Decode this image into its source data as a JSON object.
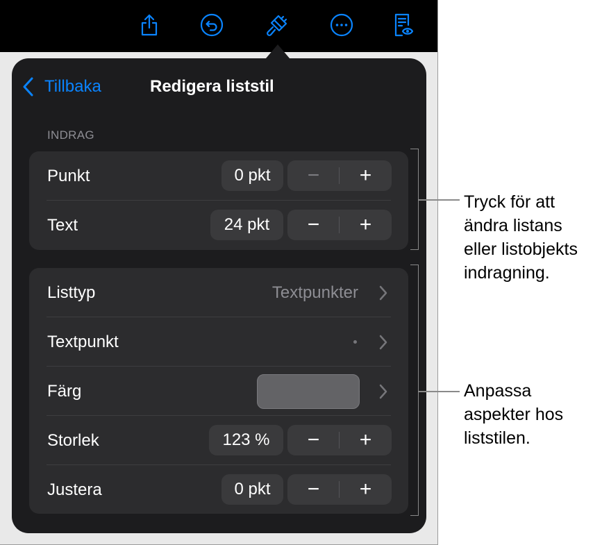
{
  "toolbar": {
    "buttons": [
      {
        "name": "share",
        "icon": "share-icon"
      },
      {
        "name": "undo",
        "icon": "undo-icon"
      },
      {
        "name": "format",
        "icon": "paintbrush-icon"
      },
      {
        "name": "more",
        "icon": "more-icon"
      },
      {
        "name": "reading-view",
        "icon": "reading-view-icon"
      }
    ],
    "accent_color": "#0a84ff"
  },
  "popover": {
    "back_label": "Tillbaka",
    "title": "Redigera liststil",
    "indent_section": {
      "header": "INDRAG",
      "rows": [
        {
          "label": "Punkt",
          "value": "0 pkt",
          "minus": "−",
          "plus": "+",
          "minus_enabled": false
        },
        {
          "label": "Text",
          "value": "24 pkt",
          "minus": "−",
          "plus": "+",
          "minus_enabled": true
        }
      ]
    },
    "style_section": {
      "list_type": {
        "label": "Listtyp",
        "value": "Textpunkter"
      },
      "bullet": {
        "label": "Textpunkt"
      },
      "color": {
        "label": "Färg",
        "swatch": "#636366"
      },
      "size": {
        "label": "Storlek",
        "value": "123 %",
        "minus": "−",
        "plus": "+"
      },
      "align": {
        "label": "Justera",
        "value": "0 pkt",
        "minus": "−",
        "plus": "+"
      }
    }
  },
  "callouts": {
    "indent_lines": [
      "Tryck för att",
      "ändra listans",
      "eller listobjekts",
      "indragning."
    ],
    "style_lines": [
      "Anpassa",
      "aspekter hos",
      "liststilen."
    ]
  }
}
